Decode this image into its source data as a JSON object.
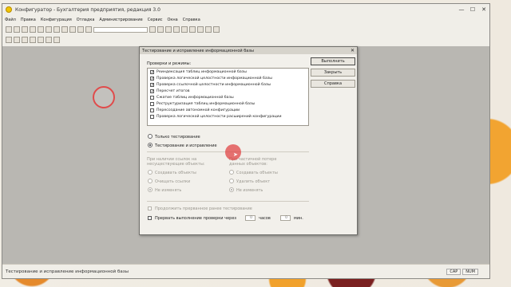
{
  "window": {
    "title": "Конфигуратор - Бухгалтерия предприятия, редакция 3.0",
    "controls": [
      "—",
      "☐",
      "✕"
    ]
  },
  "menu": [
    "Файл",
    "Правка",
    "Конфигурация",
    "Отладка",
    "Администрирование",
    "Сервис",
    "Окна",
    "Справка"
  ],
  "status_bar": {
    "text": "Тестирование и исправление информационной базы",
    "indicators": [
      "CAP",
      "NUM"
    ]
  },
  "dialog": {
    "title": "Тестирование и исправление информационной базы",
    "checks_label": "Проверки и режимы:",
    "checks": [
      {
        "label": "Реиндексация таблиц информационной базы",
        "checked": true
      },
      {
        "label": "Проверка логической целостности информационной базы",
        "checked": true
      },
      {
        "label": "Проверка ссылочной целостности информационной базы",
        "checked": true
      },
      {
        "label": "Пересчет итогов",
        "checked": true
      },
      {
        "label": "Сжатие таблиц информационной базы",
        "checked": false
      },
      {
        "label": "Реструктуризация таблиц информационной базы",
        "checked": false
      },
      {
        "label": "Пересоздание автономной конфигурации",
        "checked": false
      },
      {
        "label": "Проверка логической целостности расширений конфигурации",
        "checked": false
      }
    ],
    "mode_test_only": "Только тестирование",
    "mode_test_fix": "Тестирование и исправление",
    "refs_label_1": "При наличии ссылок на",
    "refs_label_2": "несуществующие объекты:",
    "loss_label_1": "При частичной потере",
    "loss_label_2": "данных объектов:",
    "refs_options": [
      "Создавать объекты",
      "Очищать ссылки",
      "Не изменять"
    ],
    "loss_options": [
      "Создавать объекты",
      "Удалить объект",
      "Не изменять"
    ],
    "continue_label": "Продолжить прерванное ранее тестирование",
    "interrupt_label": "Прервать выполнение проверки через",
    "hours_value": "0",
    "hours_unit": "часов",
    "minutes_value": "0",
    "minutes_unit": "мин.",
    "buttons": {
      "run": "Выполнить",
      "close": "Закрыть",
      "help": "Справка"
    }
  }
}
